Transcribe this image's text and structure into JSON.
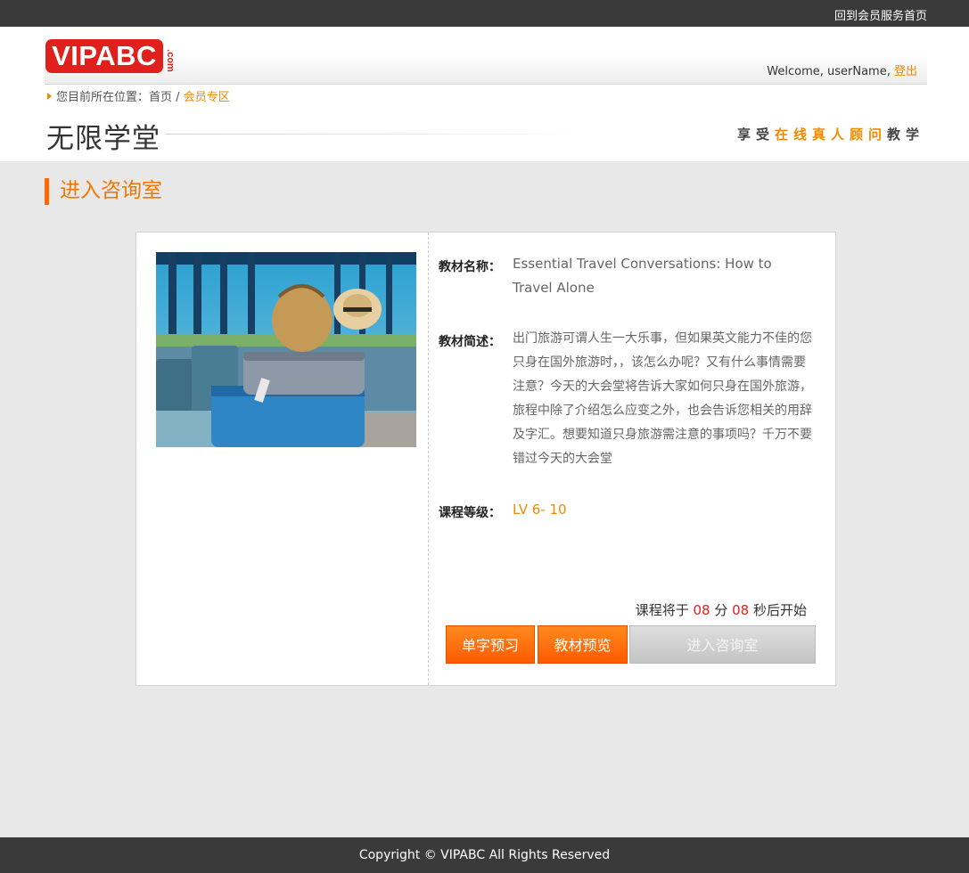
{
  "topbar": {
    "link": "回到会员服务首页"
  },
  "header": {
    "logo": "VIPABC",
    "logo_suffix": ".com",
    "welcome_prefix": "Welcome, userName, ",
    "logout": "登出"
  },
  "breadcrumb": {
    "prefix": "您目前所在位置：",
    "home": "首页",
    "separator": " / ",
    "current": "会员专区"
  },
  "site": {
    "title": "无限学堂",
    "slogan_a": "享受",
    "slogan_b": "在线真人顾问",
    "slogan_c": "教学"
  },
  "section": {
    "title": "进入咨询室"
  },
  "course": {
    "image_alt": "luggage-at-airport",
    "name_label": "教材名称：",
    "name": "Essential Travel Conversations: How to Travel Alone",
    "desc_label": "教材简述：",
    "desc": "出门旅游可谓人生一大乐事，但如果英文能力不佳的您只身在国外旅游时，，该怎么办呢？又有什么事情需要注意？今天的大会堂将告诉大家如何只身在国外旅游，旅程中除了介绍怎么应变之外，也会告诉您相关的用辞及字汇。想要知道只身旅游需注意的事项吗？千万不要错过今天的大会堂",
    "level_label": "课程等级：",
    "level": "LV 6- 10"
  },
  "countdown": {
    "prefix": "课程将于 ",
    "minutes": "08",
    "min_unit": " 分 ",
    "seconds": "08",
    "suffix": " 秒后开始"
  },
  "buttons": {
    "vocab": "单字预习",
    "preview": "教材预览",
    "enter": "进入咨询室"
  },
  "colors": {
    "accent": "#f08a00",
    "brand": "#e0201c",
    "button": "#ff6a00"
  },
  "footer": {
    "copyright": "Copyright © VIPABC All Rights Reserved"
  }
}
